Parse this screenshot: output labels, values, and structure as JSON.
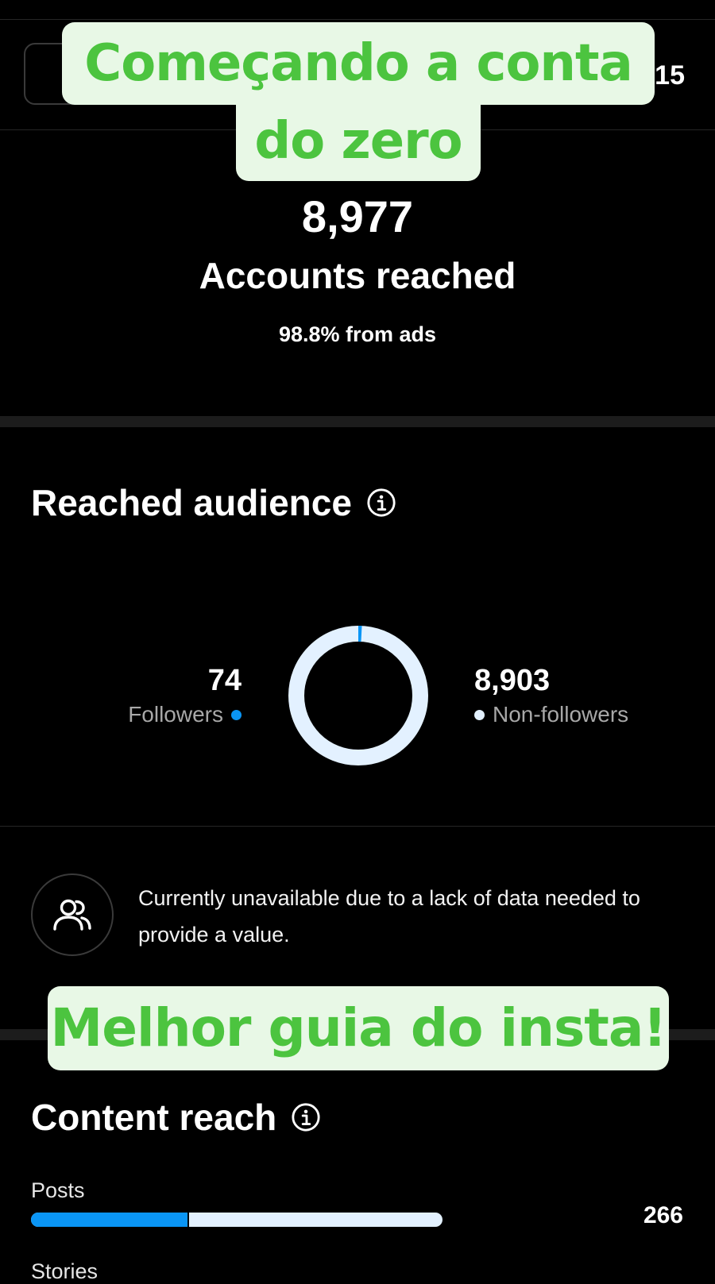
{
  "header": {
    "date_suffix": "15"
  },
  "captions": {
    "top_line1": "Começando a conta",
    "top_line2": "do zero",
    "bottom": "Melhor guia do insta!"
  },
  "summary": {
    "accounts_reached_value": "8,977",
    "accounts_reached_label": "Accounts reached",
    "ads_share_text": "98.8% from ads"
  },
  "reached_audience": {
    "title": "Reached audience",
    "info_icon": "info-icon",
    "followers": {
      "count": "74",
      "label": "Followers",
      "value": 74,
      "color": "#0a95f5"
    },
    "non_followers": {
      "count": "8,903",
      "label": "Non-followers",
      "value": 8903,
      "color": "#e3f1ff"
    },
    "notice": {
      "icon": "people-icon",
      "text": "Currently unavailable due to a lack of data needed to provide a value."
    }
  },
  "content_reach": {
    "title": "Content reach",
    "info_icon": "info-icon",
    "posts": {
      "label": "Posts",
      "value": "266",
      "bar_fraction": 0.38
    },
    "stories": {
      "label": "Stories"
    }
  },
  "colors": {
    "background": "#000000",
    "accent_blue": "#0a95f5",
    "light_blue": "#e3f1ff",
    "caption_green": "#4cc43f",
    "caption_bg": "#e8f8e6"
  }
}
